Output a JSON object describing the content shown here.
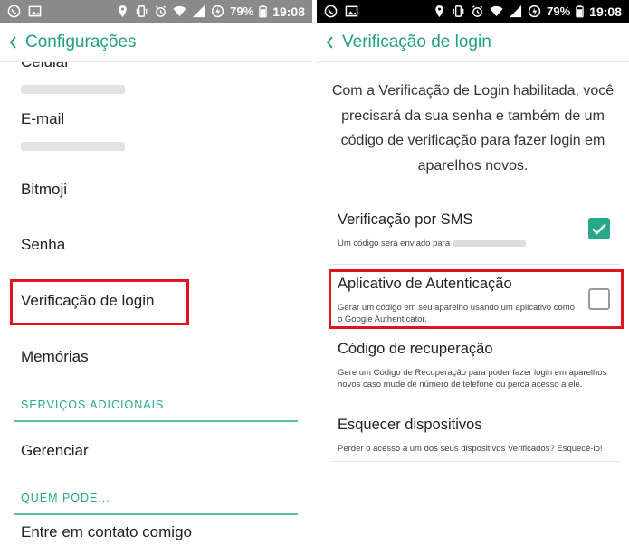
{
  "left": {
    "status": {
      "battery": "79%",
      "time": "19:08"
    },
    "header": {
      "title": "Configurações"
    },
    "items": {
      "celular": "Celular",
      "email": "E-mail",
      "bitmoji": "Bitmoji",
      "senha": "Senha",
      "verificacao": "Verificação de login",
      "memorias": "Memórias",
      "gerenciar": "Gerenciar",
      "contato": "Entre em contato comigo"
    },
    "sections": {
      "servicos": "SERVIÇOS ADICIONAIS",
      "quem_pode": "QUEM PODE..."
    }
  },
  "right": {
    "status": {
      "battery": "79%",
      "time": "19:08"
    },
    "header": {
      "title": "Verificação de login"
    },
    "intro": "Com a Verificação de Login habilitada, você precisará da sua senha e também de um código de verificação para fazer login em aparelhos novos.",
    "sms": {
      "title": "Verificação por SMS",
      "desc": "Um código será enviado para",
      "checked": true
    },
    "auth_app": {
      "title": "Aplicativo de Autenticação",
      "desc": "Gerar um código em seu aparelho usando um aplicativo como o Google Authenticator.",
      "checked": false
    },
    "recovery": {
      "title": "Código de recuperação",
      "desc": "Gere um Código de Recuperação para poder fazer login em aparelhos novos caso mude de número de telefone ou perca acesso a ele."
    },
    "forget": {
      "title": "Esquecer dispositivos",
      "desc": "Perder o acesso a um dos seus dispositivos Verificados? Esquecê-lo!"
    }
  },
  "colors": {
    "accent": "#27a88b",
    "highlight": "#e0141e"
  }
}
